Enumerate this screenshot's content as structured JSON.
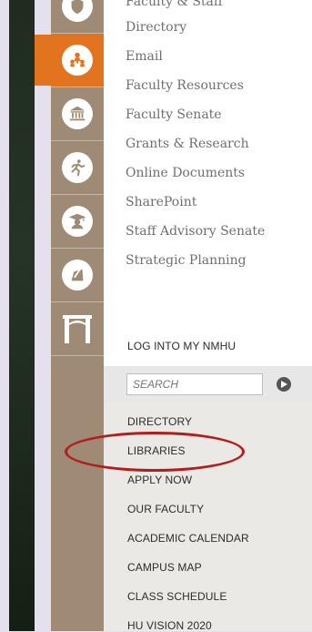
{
  "top_partial_label": "Faculty & Staff",
  "serif_menu": [
    "Directory",
    "Email",
    "Faculty Resources",
    "Faculty Senate",
    "Grants & Research",
    "Online Documents",
    "SharePoint",
    "Staff Advisory Senate",
    "Strategic Planning"
  ],
  "login_label": "LOG INTO MY NMHU",
  "search": {
    "placeholder": "SEARCH"
  },
  "quick_links": [
    "DIRECTORY",
    "LIBRARIES",
    "APPLY NOW",
    "OUR FACULTY",
    "ACADEMIC CALENDAR",
    "CAMPUS MAP",
    "CLASS SCHEDULE",
    "HU VISION 2020"
  ],
  "icons": [
    "shield-icon",
    "people-icon",
    "columns-building-icon",
    "runner-icon",
    "graduate-icon",
    "pencil-note-icon",
    "archway-icon"
  ],
  "colors": {
    "accent": "#e2731f",
    "icon_column": "#9f8b75",
    "highlight_ellipse": "#b01e1e"
  }
}
